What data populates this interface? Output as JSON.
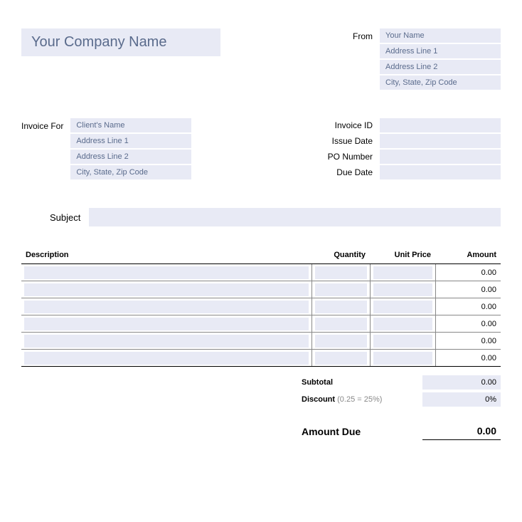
{
  "company": {
    "placeholder": "Your Company Name"
  },
  "from": {
    "label": "From",
    "fields": {
      "name": "Your Name",
      "addr1": "Address Line 1",
      "addr2": "Address Line 2",
      "city": "City, State, Zip Code"
    }
  },
  "invoice_for": {
    "label": "Invoice For",
    "fields": {
      "name": "Client's Name",
      "addr1": "Address Line 1",
      "addr2": "Address Line 2",
      "city": "City, State, Zip Code"
    }
  },
  "meta": {
    "invoice_id": {
      "label": "Invoice ID",
      "value": ""
    },
    "issue_date": {
      "label": "Issue Date",
      "value": ""
    },
    "po_number": {
      "label": "PO Number",
      "value": ""
    },
    "due_date": {
      "label": "Due Date",
      "value": ""
    }
  },
  "subject": {
    "label": "Subject",
    "value": ""
  },
  "columns": {
    "description": "Description",
    "quantity": "Quantity",
    "unit_price": "Unit Price",
    "amount": "Amount"
  },
  "rows": [
    {
      "desc": "",
      "qty": "",
      "price": "",
      "amount": "0.00"
    },
    {
      "desc": "",
      "qty": "",
      "price": "",
      "amount": "0.00"
    },
    {
      "desc": "",
      "qty": "",
      "price": "",
      "amount": "0.00"
    },
    {
      "desc": "",
      "qty": "",
      "price": "",
      "amount": "0.00"
    },
    {
      "desc": "",
      "qty": "",
      "price": "",
      "amount": "0.00"
    },
    {
      "desc": "",
      "qty": "",
      "price": "",
      "amount": "0.00"
    }
  ],
  "totals": {
    "subtotal": {
      "label": "Subtotal",
      "value": "0.00"
    },
    "discount": {
      "label": "Discount",
      "hint": "(0.25 = 25%)",
      "value": "0%"
    },
    "amount_due": {
      "label": "Amount Due",
      "value": "0.00"
    }
  }
}
